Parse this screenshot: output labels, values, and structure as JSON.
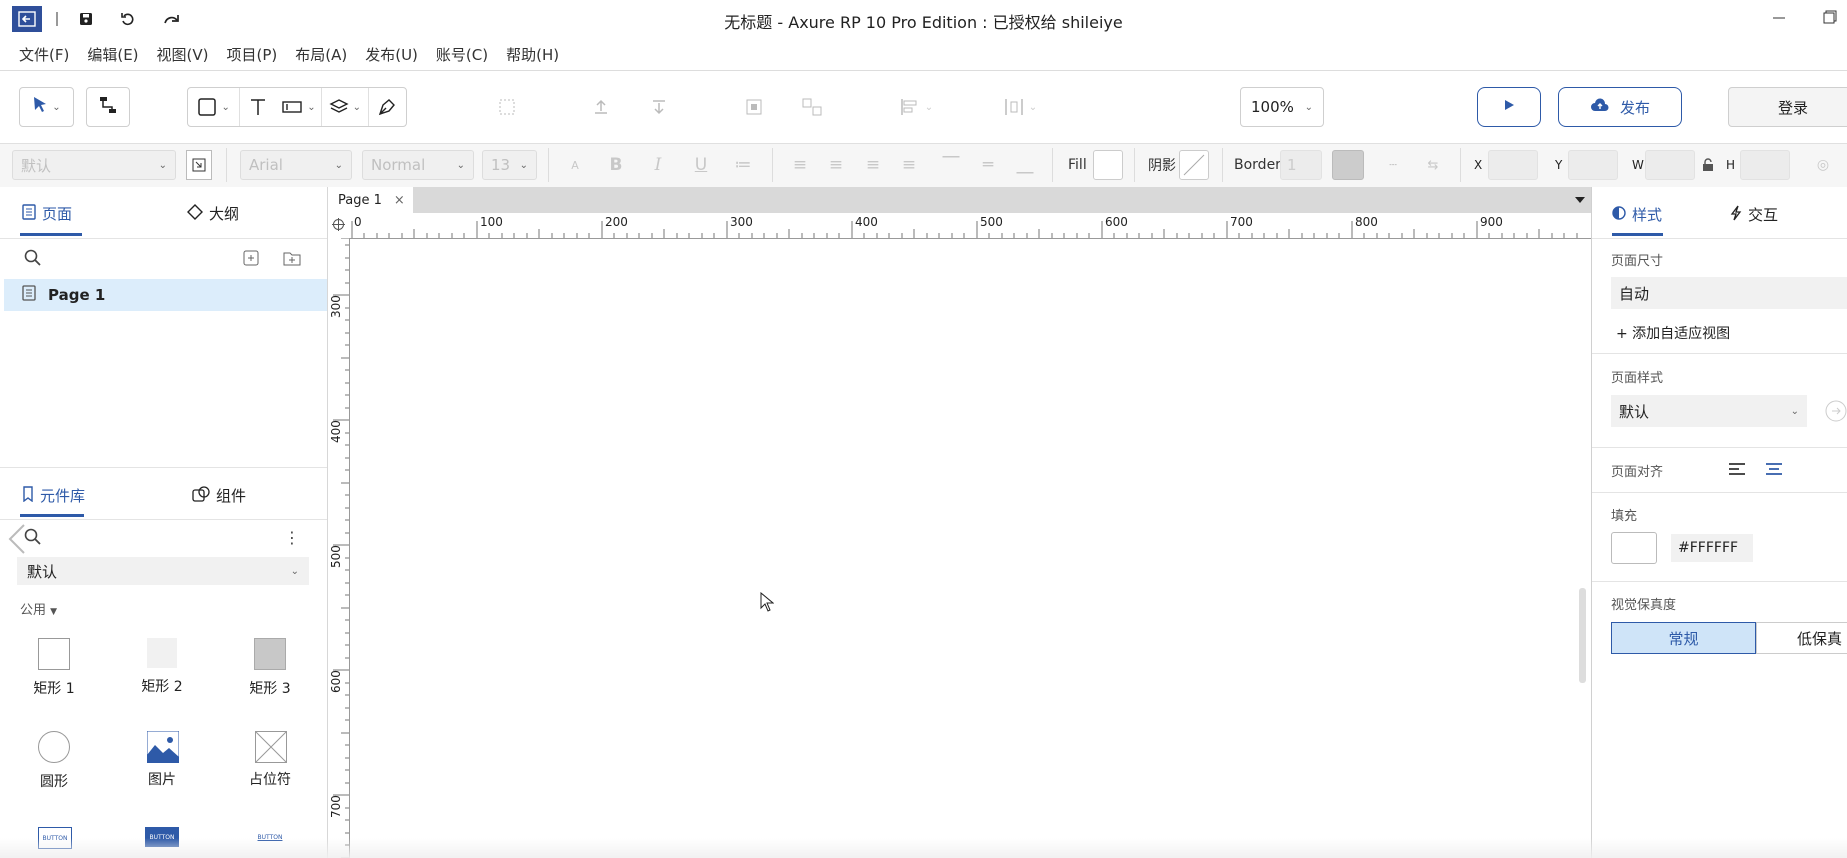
{
  "window": {
    "title": "无标题 - Axure RP 10 Pro Edition : 已授权给 shileiye"
  },
  "menu": [
    "文件(F)",
    "编辑(E)",
    "视图(V)",
    "项目(P)",
    "布局(A)",
    "发布(U)",
    "账号(C)",
    "帮助(H)"
  ],
  "toolbar": {
    "zoom": "100%",
    "publish_label": "发布",
    "login_label": "登录"
  },
  "format": {
    "style": "默认",
    "font": "Arial",
    "weight": "Normal",
    "size": "13",
    "fill_label": "Fill",
    "shadow_label": "阴影",
    "border_label": "Border",
    "border_width": "1",
    "x_label": "X",
    "y_label": "Y",
    "w_label": "W",
    "h_label": "H"
  },
  "left_panel": {
    "tab_pages": "页面",
    "tab_outline": "大纲",
    "page_item": "Page 1",
    "tab_library": "元件库",
    "tab_components": "组件",
    "library_select": "默认",
    "section": "公用",
    "widgets": [
      "矩形 1",
      "矩形 2",
      "矩形 3",
      "圆形",
      "图片",
      "占位符"
    ],
    "button_text": "BUTTON"
  },
  "canvas": {
    "tab": "Page 1",
    "ruler_h": [
      "0",
      "100",
      "200",
      "300",
      "400",
      "500",
      "600",
      "700",
      "800",
      "900"
    ],
    "ruler_v": [
      "300",
      "400",
      "500",
      "600",
      "700"
    ]
  },
  "right_panel": {
    "tab_style": "样式",
    "tab_interact": "交互",
    "page_size_label": "页面尺寸",
    "page_size": "自动",
    "add_view": "+ 添加自适应视图",
    "page_style_label": "页面样式",
    "page_style": "默认",
    "align_label": "页面对齐",
    "fill_label": "填充",
    "fill_hex": "#FFFFFF",
    "fidelity_label": "视觉保真度",
    "fidelity_normal": "常规",
    "fidelity_low": "低保真"
  },
  "colors": {
    "accent": "#2e5aa8",
    "selected_row": "#dcedfb"
  }
}
